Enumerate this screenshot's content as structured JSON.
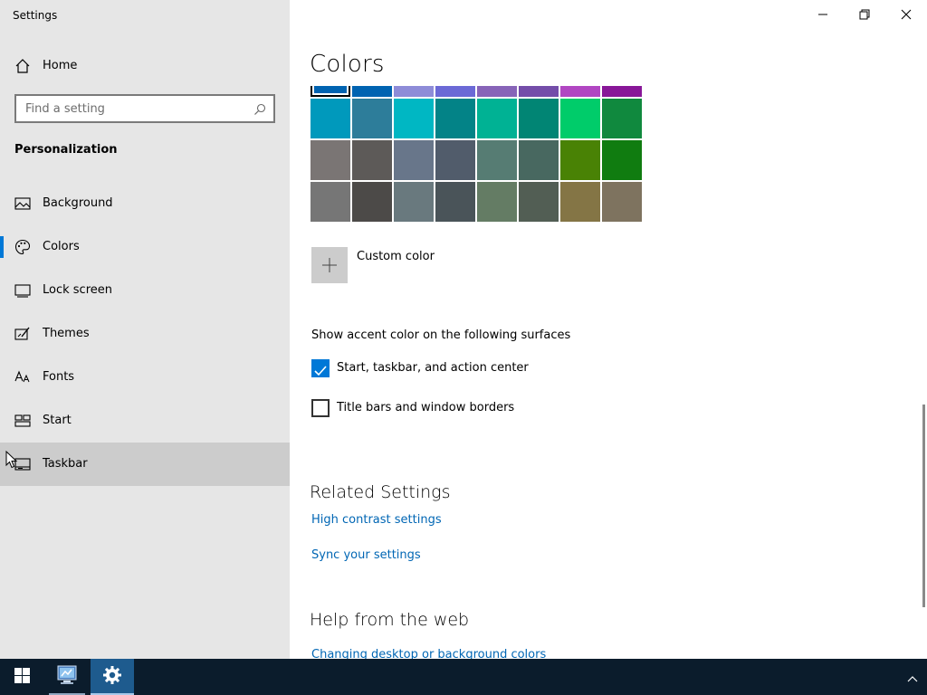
{
  "window": {
    "title": "Settings",
    "controls": [
      "minimize",
      "maximize",
      "close"
    ]
  },
  "sidebar": {
    "home_label": "Home",
    "search_placeholder": "Find a setting",
    "section_title": "Personalization",
    "items": [
      {
        "label": "Background",
        "icon": "picture-icon",
        "selected": false
      },
      {
        "label": "Colors",
        "icon": "palette-icon",
        "selected": true
      },
      {
        "label": "Lock screen",
        "icon": "lock-screen-icon",
        "selected": false
      },
      {
        "label": "Themes",
        "icon": "themes-icon",
        "selected": false
      },
      {
        "label": "Fonts",
        "icon": "fonts-icon",
        "selected": false
      },
      {
        "label": "Start",
        "icon": "start-icon",
        "selected": false
      },
      {
        "label": "Taskbar",
        "icon": "taskbar-icon",
        "selected": false,
        "hover": true
      }
    ]
  },
  "main": {
    "title": "Colors",
    "swatch_rows": [
      [
        "#0063b1",
        "#0063b1",
        "#8e8cd8",
        "#6b69d6",
        "#8764b8",
        "#744da9",
        "#b146c2",
        "#881798"
      ],
      [
        "#0099bc",
        "#2d7d9a",
        "#00b7c3",
        "#038387",
        "#00b294",
        "#018574",
        "#00cc6a",
        "#10893e"
      ],
      [
        "#7a7574",
        "#5d5a58",
        "#68768a",
        "#515c6b",
        "#567c73",
        "#486860",
        "#498205",
        "#107c10"
      ],
      [
        "#767676",
        "#4c4a48",
        "#69797e",
        "#4a5459",
        "#647c64",
        "#525e54",
        "#847545",
        "#7e735f"
      ]
    ],
    "custom_color_label": "Custom color",
    "surfaces_title": "Show accent color on the following surfaces",
    "checkboxes": [
      {
        "label": "Start, taskbar, and action center",
        "checked": true
      },
      {
        "label": "Title bars and window borders",
        "checked": false
      }
    ],
    "related_title": "Related Settings",
    "related_links": [
      "High contrast settings",
      "Sync your settings"
    ],
    "help_title": "Help from the web",
    "help_links": [
      "Changing desktop or background colors"
    ]
  },
  "colors": {
    "accent": "#0078d7",
    "link": "#0066b4",
    "sidebar_bg": "#e6e6e6",
    "taskbar_bg": "#0b1c2c"
  }
}
